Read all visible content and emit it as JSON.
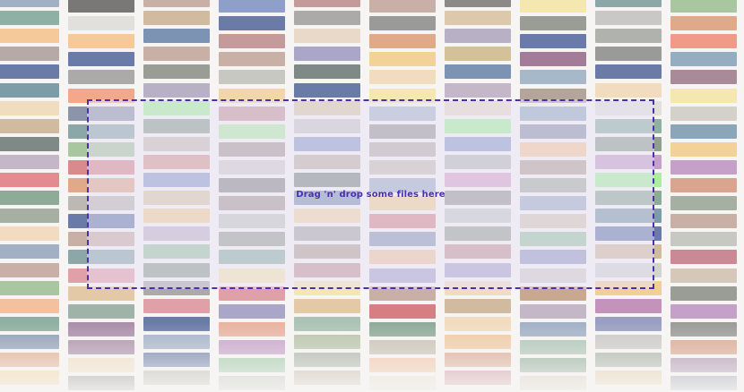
{
  "dropzone": {
    "label": "Drag 'n' drop some files here",
    "border_color": "#4a2fb0",
    "text_color": "#4a2fb0"
  },
  "background": {
    "page_color": "#f6f5f3",
    "palette": [
      "#e8d9c8",
      "#efe3cf",
      "#f4e7b0",
      "#f3d29a",
      "#f2cf96",
      "#f6e3a0",
      "#eec9a2",
      "#f1dcc0",
      "#dcc8aa",
      "#fdf7a6",
      "#d3c19a",
      "#f6c99b",
      "#f3d6a8",
      "#c7bfb2",
      "#e4c9a6",
      "#f2c1a0",
      "#e0a98a",
      "#d9a58e",
      "#f5a78c",
      "#f29a8a",
      "#e9b3a2",
      "#d49c90",
      "#c9b0a6",
      "#b7aaa6",
      "#9a8e8e",
      "#c59a9a",
      "#d88a8c",
      "#e38c8f",
      "#d77d84",
      "#c98a95",
      "#a88a98",
      "#e0a0a8",
      "#d6a6c6",
      "#a98ea8",
      "#aaa6c8",
      "#c493bb",
      "#a27c98",
      "#c5a0c8",
      "#b8b0c4",
      "#c4b7c8",
      "#8c94aa",
      "#8d8cb5",
      "#6a7ba8",
      "#8fa0c8",
      "#9a9ec2",
      "#7d93b4",
      "#8d9bb5",
      "#a2b0c6",
      "#7c9ca8",
      "#8aa6b8",
      "#95adc0",
      "#a7b9c8",
      "#8ca7a8",
      "#8fb0a4",
      "#7d9a96",
      "#9bb8b0",
      "#7f8a86",
      "#9a9c96",
      "#a8a6a0",
      "#8c8a86",
      "#b0b2ad",
      "#99a397",
      "#8f9f91",
      "#a5b0a3",
      "#a8c6a0",
      "#9cc7a4",
      "#b6c2a8",
      "#abc3b4",
      "#c4cbc6",
      "#d2d4d0",
      "#b9bcb8",
      "#c7c8c2",
      "#a6f0a0",
      "#b4ecaa",
      "#9fb3a8",
      "#8eaa98",
      "#a9a9a9",
      "#b8b8b8",
      "#c6c6c4",
      "#9a9a98",
      "#b8b2aa",
      "#c9c0b4",
      "#a89e94",
      "#bfb3a4",
      "#d1bba0",
      "#c8a88e",
      "#b3a698",
      "#d6c8b8",
      "#8a8a88",
      "#9c9a98",
      "#7a7876",
      "#acaaa8",
      "#d4d0ca",
      "#e2e0dc",
      "#bcb8b4",
      "#cac8c6"
    ]
  }
}
